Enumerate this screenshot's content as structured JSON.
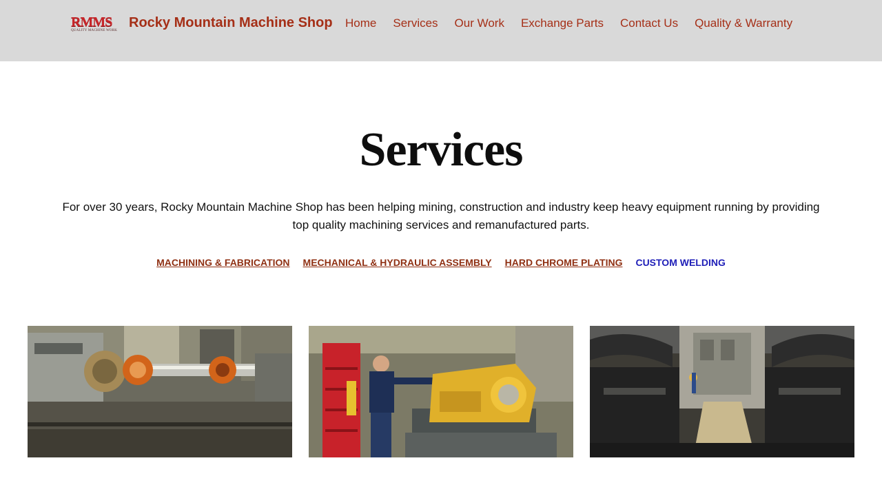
{
  "header": {
    "logo_text": "RMMS",
    "logo_tagline": "QUALITY MACHINE WORK",
    "site_title": "Rocky Mountain Machine Shop"
  },
  "nav": {
    "home": "Home",
    "services": "Services",
    "our_work": "Our Work",
    "exchange_parts": "Exchange Parts",
    "contact_us": "Contact Us",
    "quality_warranty": "Quality & Warranty"
  },
  "main": {
    "title": "Services",
    "intro": "For over 30 years, Rocky Mountain Machine Shop has been helping mining, construction and industry keep heavy equipment running by providing top quality machining services and remanufactured parts.",
    "service_links": {
      "machining": "MACHINING & FABRICATION",
      "assembly": "MECHANICAL & HYDRAULIC ASSEMBLY",
      "chrome": "HARD CHROME PLATING",
      "welding": "CUSTOM WELDING"
    }
  },
  "colors": {
    "header_bg": "#d9d9d9",
    "brand": "#a52f17",
    "link": "#8f3013",
    "active_link": "#1f1fb8"
  }
}
